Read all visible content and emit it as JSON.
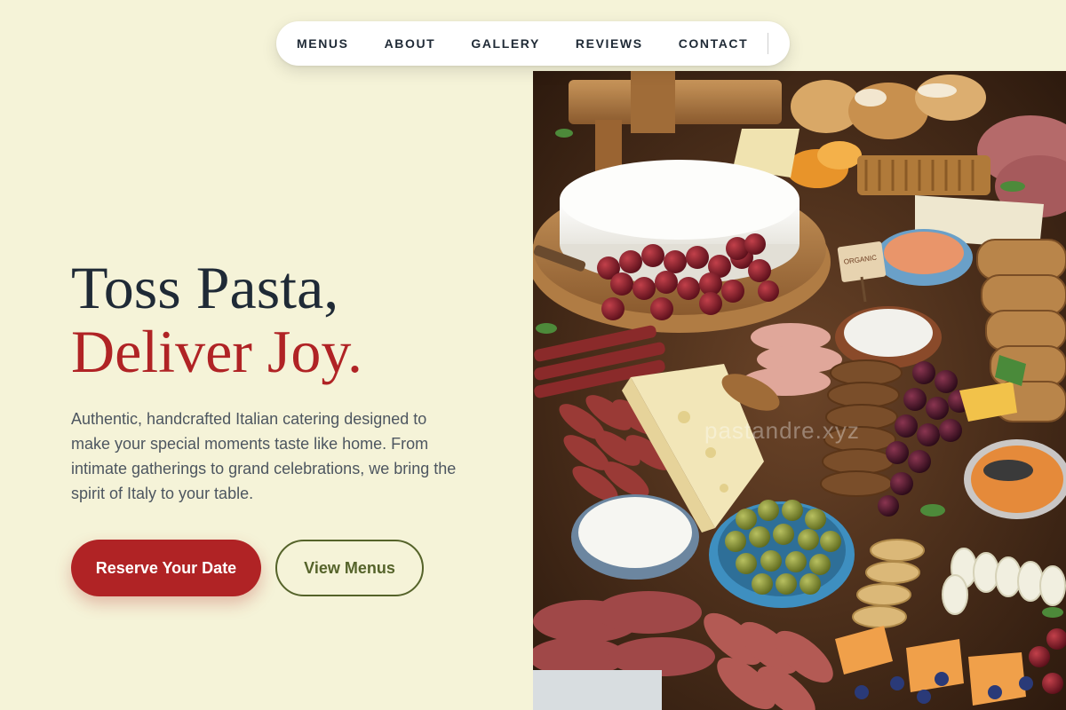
{
  "nav": {
    "items": [
      {
        "label": "MENUS"
      },
      {
        "label": "ABOUT"
      },
      {
        "label": "GALLERY"
      },
      {
        "label": "REVIEWS"
      },
      {
        "label": "CONTACT"
      }
    ]
  },
  "hero": {
    "title_line1": "Toss Pasta,",
    "title_line2": "Deliver Joy.",
    "description": "Authentic, handcrafted Italian catering designed to make your special moments taste like home. From intimate gatherings to grand celebrations, we bring the spirit of Italy to your table.",
    "primary_button": "Reserve Your Date",
    "secondary_button": "View Menus"
  },
  "photo": {
    "watermark": "pastandre.xyz",
    "sign_text": "ORGANIC"
  },
  "colors": {
    "background": "#f5f3d8",
    "accent_red": "#b02325",
    "olive": "#55632a",
    "heading": "#1f2a36"
  }
}
